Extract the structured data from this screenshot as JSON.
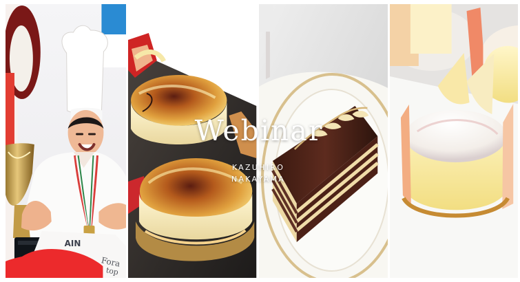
{
  "banner": {
    "title": "Webinar",
    "name_first": "KAZUHIRO",
    "name_last": "NAKAYAMA",
    "colors": {
      "text": "#ffffff",
      "caramel": "#d67a1d",
      "chocolate": "#4e2418",
      "cream": "#f3e6b7",
      "pink": "#f2a58a"
    }
  },
  "photos": [
    {
      "subject": "pastry chef holding trophy"
    },
    {
      "subject": "creme brulee cheesecakes"
    },
    {
      "subject": "chocolate opera cake"
    },
    {
      "subject": "lemon mousse cakes"
    }
  ],
  "photo_text": {
    "apron_text": "AIN",
    "paper_text": "Fora",
    "paper_text_2": "top"
  }
}
